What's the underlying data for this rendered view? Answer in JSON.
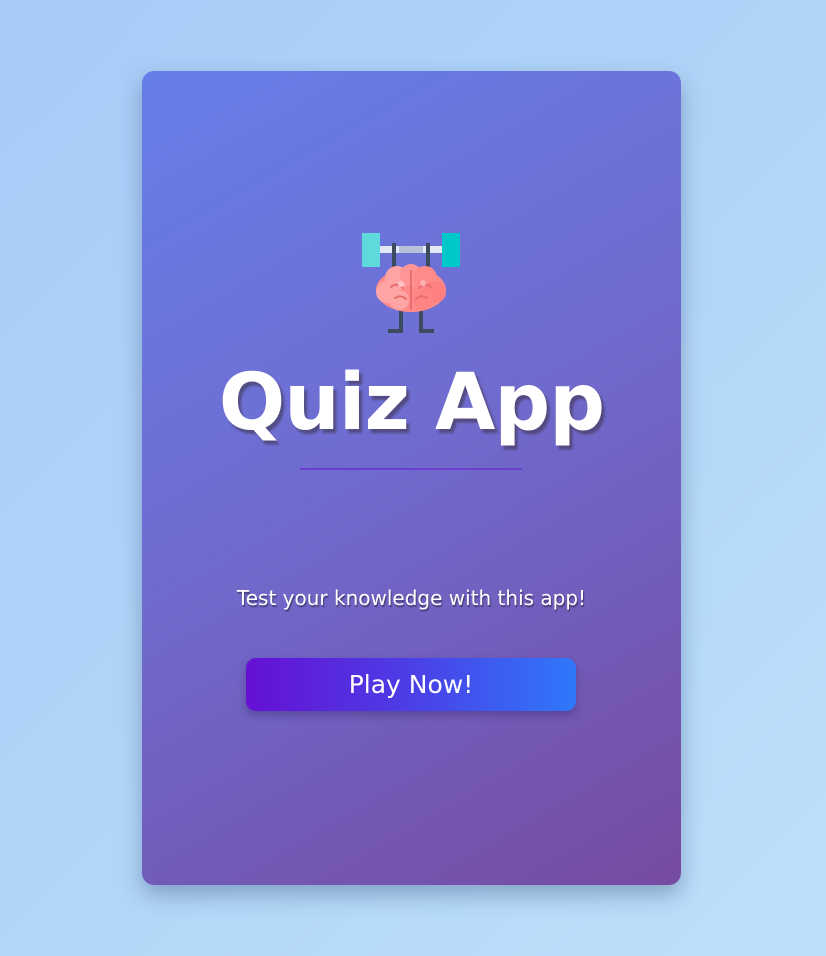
{
  "card": {
    "title": "Quiz App",
    "tagline": "Test your knowledge with this app!",
    "play_button_label": "Play Now!",
    "logo_icon": "brain-lifting-barbell-icon"
  },
  "colors": {
    "background": "#b2d6f8",
    "card_gradient_start": "#667eea",
    "card_gradient_end": "#764ba2",
    "button_gradient_start": "#6610d4",
    "button_gradient_end": "#2f78fa",
    "divider": "#6a3fd0"
  }
}
